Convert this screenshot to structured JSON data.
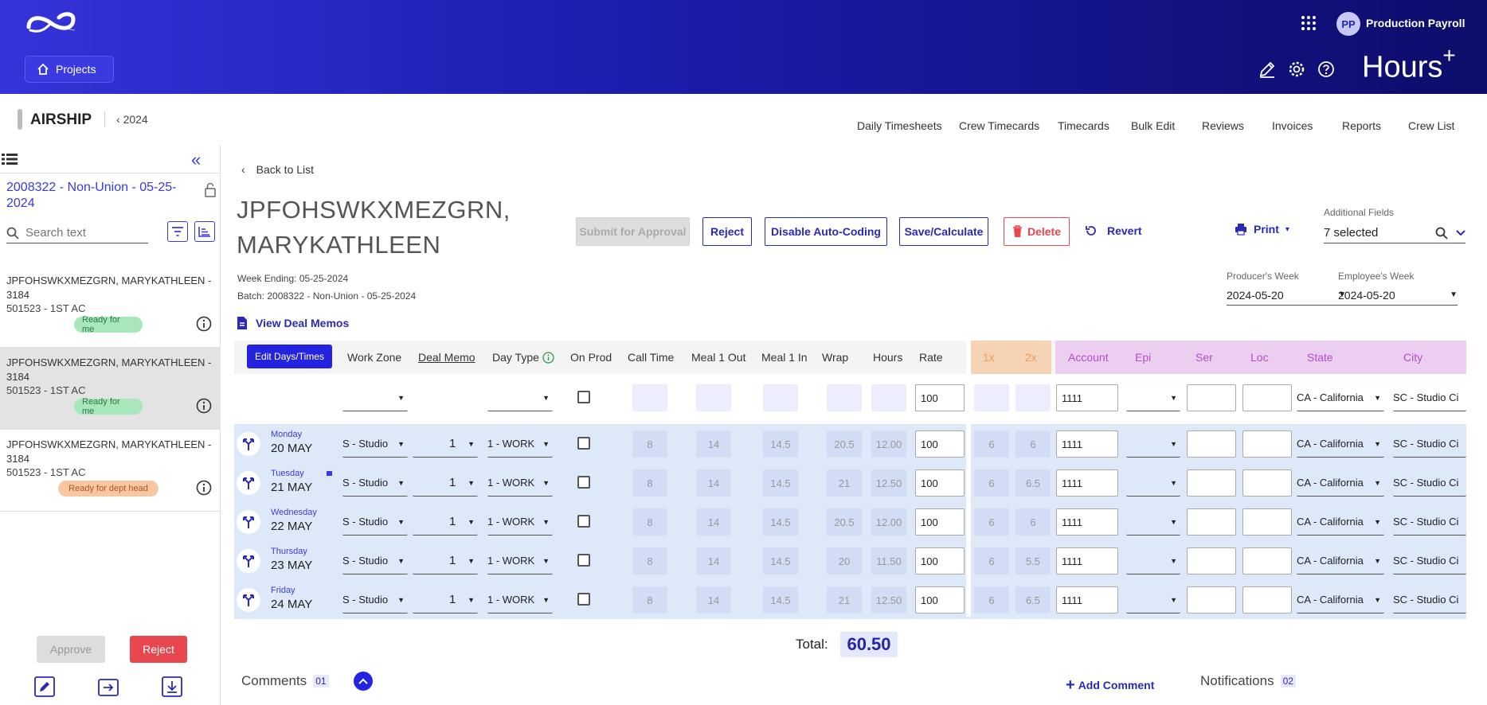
{
  "header": {
    "projects_label": "Projects",
    "user_initials": "PP",
    "user_name": "Production Payroll",
    "brand": "Hours",
    "brand_sup": "+",
    "colors": {
      "primary": "#2424e0",
      "danger": "#e8474f",
      "dark_header": "#0d0d6b"
    }
  },
  "project": {
    "name": "AIRSHIP",
    "year": "2024"
  },
  "topnav": [
    "Daily Timesheets",
    "Crew Timecards",
    "Timecards",
    "Bulk Edit",
    "Reviews",
    "Invoices",
    "Reports",
    "Crew List"
  ],
  "sidebar": {
    "batch": "2008322 - Non-Union - 05-25-2024",
    "search_placeholder": "Search text",
    "items": [
      {
        "name": "JPFOHSWKXMEZGRN, MARYKATHLEEN - 3184",
        "occupation": "501523 - 1ST AC",
        "status": "Ready for me"
      },
      {
        "name": "JPFOHSWKXMEZGRN, MARYKATHLEEN - 3184",
        "occupation": "501523 - 1ST AC",
        "status": "Ready for me"
      },
      {
        "name": "JPFOHSWKXMEZGRN, MARYKATHLEEN - 3184",
        "occupation": "501523 - 1ST AC",
        "status": "Ready for dept head"
      }
    ],
    "approve_label": "Approve",
    "reject_label": "Reject"
  },
  "main": {
    "back_label": "Back to List",
    "employee_line1": "JPFOHSWKXMEZGRN,",
    "employee_line2": "MARYKATHLEEN",
    "week_ending": "Week Ending: 05-25-2024",
    "batch": "Batch: 2008322 - Non-Union - 05-25-2024",
    "view_deal_memos": "View Deal Memos",
    "actions": {
      "submit": "Submit for Approval",
      "reject": "Reject",
      "disable_auto": "Disable Auto-Coding",
      "save": "Save/Calculate",
      "delete": "Delete",
      "revert": "Revert",
      "print": "Print"
    },
    "additional_fields_label": "Additional Fields",
    "additional_fields_value": "7 selected",
    "producers_week_label": "Producer's Week",
    "producers_week_value": "2024-05-20",
    "employees_week_label": "Employee's Week",
    "employees_week_value": "2024-05-20"
  },
  "table": {
    "edit_days_label": "Edit Days/Times",
    "columns": {
      "work_zone": "Work Zone",
      "deal_memo": "Deal Memo",
      "day_type": "Day Type",
      "on_prod": "On Prod",
      "call_time": "Call Time",
      "meal1_out": "Meal 1 Out",
      "meal1_in": "Meal 1 In",
      "wrap": "Wrap",
      "hours": "Hours",
      "rate": "Rate",
      "x1": "1x",
      "x2": "2x",
      "account": "Account",
      "epi": "Epi",
      "ser": "Ser",
      "loc": "Loc",
      "state": "State",
      "city": "City"
    },
    "template_row": {
      "rate": "100",
      "account": "1111",
      "state": "CA - California",
      "city": "SC - Studio Ci"
    },
    "rows": [
      {
        "day": "Monday",
        "date": "20 MAY",
        "work_zone": "S - Studio",
        "deal_memo": "1",
        "day_type": "1 - WORK",
        "call": "8",
        "meal_out": "14",
        "meal_in": "14.5",
        "wrap": "20.5",
        "hours": "12.00",
        "rate": "100",
        "x1": "6",
        "x2": "6",
        "account": "1111",
        "state": "CA - California",
        "city": "SC - Studio Ci"
      },
      {
        "day": "Tuesday",
        "date": "21 MAY",
        "work_zone": "S - Studio",
        "deal_memo": "1",
        "day_type": "1 - WORK",
        "call": "8",
        "meal_out": "14",
        "meal_in": "14.5",
        "wrap": "21",
        "hours": "12.50",
        "rate": "100",
        "x1": "6",
        "x2": "6.5",
        "account": "1111",
        "state": "CA - California",
        "city": "SC - Studio Ci"
      },
      {
        "day": "Wednesday",
        "date": "22 MAY",
        "work_zone": "S - Studio",
        "deal_memo": "1",
        "day_type": "1 - WORK",
        "call": "8",
        "meal_out": "14",
        "meal_in": "14.5",
        "wrap": "20.5",
        "hours": "12.00",
        "rate": "100",
        "x1": "6",
        "x2": "6",
        "account": "1111",
        "state": "CA - California",
        "city": "SC - Studio Ci"
      },
      {
        "day": "Thursday",
        "date": "23 MAY",
        "work_zone": "S - Studio",
        "deal_memo": "1",
        "day_type": "1 - WORK",
        "call": "8",
        "meal_out": "14",
        "meal_in": "14.5",
        "wrap": "20",
        "hours": "11.50",
        "rate": "100",
        "x1": "6",
        "x2": "5.5",
        "account": "1111",
        "state": "CA - California",
        "city": "SC - Studio Ci"
      },
      {
        "day": "Friday",
        "date": "24 MAY",
        "work_zone": "S - Studio",
        "deal_memo": "1",
        "day_type": "1 - WORK",
        "call": "8",
        "meal_out": "14",
        "meal_in": "14.5",
        "wrap": "21",
        "hours": "12.50",
        "rate": "100",
        "x1": "6",
        "x2": "6.5",
        "account": "1111",
        "state": "CA - California",
        "city": "SC - Studio Ci"
      }
    ],
    "total_label": "Total:",
    "total_value": "60.50"
  },
  "footer": {
    "comments_label": "Comments",
    "comments_count": "01",
    "add_comment": "Add Comment",
    "notifications_label": "Notifications",
    "notifications_count": "02"
  }
}
